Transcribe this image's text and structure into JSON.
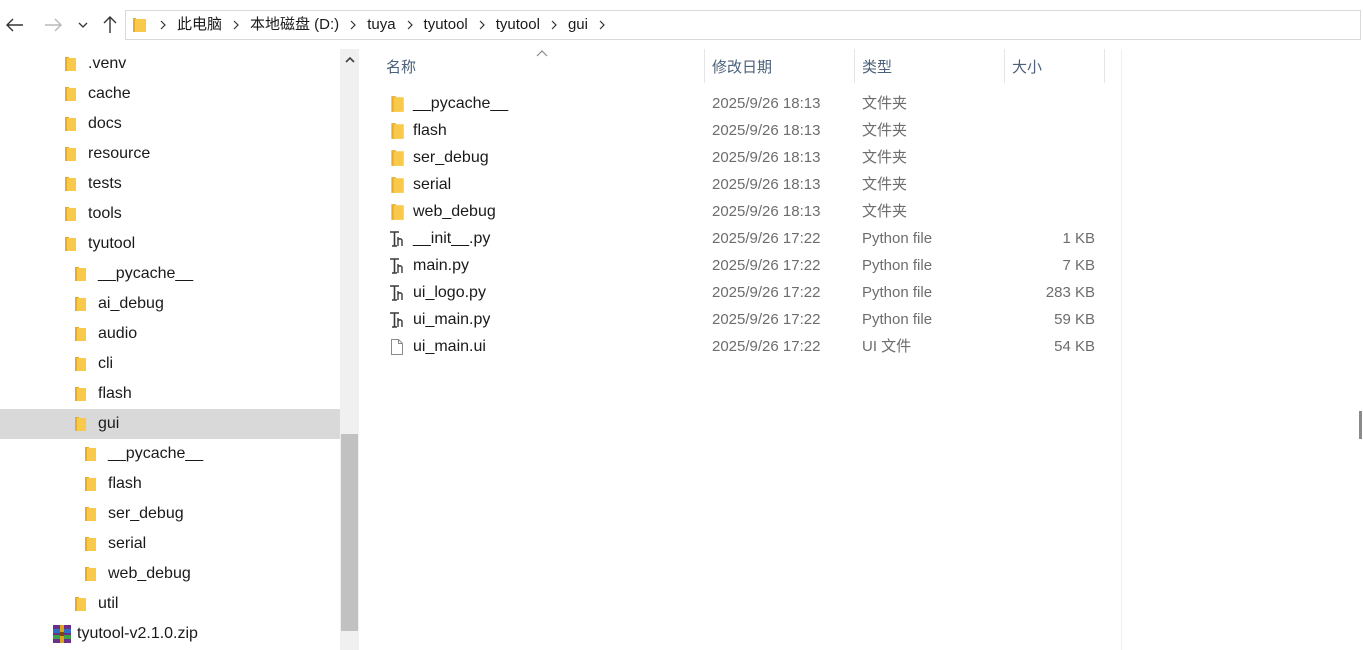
{
  "navigation": {
    "back_icon": "arrow-left-icon",
    "forward_icon": "arrow-right-icon",
    "recent_icon": "chevron-down-icon",
    "up_icon": "arrow-up-icon"
  },
  "breadcrumb": [
    "此电脑",
    "本地磁盘 (D:)",
    "tuya",
    "tyutool",
    "tyutool",
    "gui"
  ],
  "sidebar": {
    "items": [
      {
        "label": ".venv",
        "icon": "folder-icon"
      },
      {
        "label": "cache",
        "icon": "folder-icon"
      },
      {
        "label": "docs",
        "icon": "folder-icon"
      },
      {
        "label": "resource",
        "icon": "folder-icon"
      },
      {
        "label": "tests",
        "icon": "folder-icon"
      },
      {
        "label": "tools",
        "icon": "folder-icon"
      },
      {
        "label": "tyutool",
        "icon": "folder-icon"
      },
      {
        "label": "__pycache__",
        "icon": "folder-icon"
      },
      {
        "label": "ai_debug",
        "icon": "folder-icon"
      },
      {
        "label": "audio",
        "icon": "folder-icon"
      },
      {
        "label": "cli",
        "icon": "folder-icon"
      },
      {
        "label": "flash",
        "icon": "folder-icon"
      },
      {
        "label": "gui",
        "icon": "folder-icon",
        "selected": true
      },
      {
        "label": "__pycache__",
        "icon": "folder-icon"
      },
      {
        "label": "flash",
        "icon": "folder-icon"
      },
      {
        "label": "ser_debug",
        "icon": "folder-icon"
      },
      {
        "label": "serial",
        "icon": "folder-icon"
      },
      {
        "label": "web_debug",
        "icon": "folder-icon"
      },
      {
        "label": "util",
        "icon": "folder-icon"
      },
      {
        "label": "tyutool-v2.1.0.zip",
        "icon": "zip-archive-icon"
      }
    ]
  },
  "columns": {
    "name": "名称",
    "modified": "修改日期",
    "type": "类型",
    "size": "大小"
  },
  "files": [
    {
      "name": "__pycache__",
      "modified": "2025/9/26 18:13",
      "type": "文件夹",
      "size": "",
      "icon": "folder-icon"
    },
    {
      "name": "flash",
      "modified": "2025/9/26 18:13",
      "type": "文件夹",
      "size": "",
      "icon": "folder-icon"
    },
    {
      "name": "ser_debug",
      "modified": "2025/9/26 18:13",
      "type": "文件夹",
      "size": "",
      "icon": "folder-icon"
    },
    {
      "name": "serial",
      "modified": "2025/9/26 18:13",
      "type": "文件夹",
      "size": "",
      "icon": "folder-icon"
    },
    {
      "name": "web_debug",
      "modified": "2025/9/26 18:13",
      "type": "文件夹",
      "size": "",
      "icon": "folder-icon"
    },
    {
      "name": "__init__.py",
      "modified": "2025/9/26 17:22",
      "type": "Python file",
      "size": "1 KB",
      "icon": "python-file-icon"
    },
    {
      "name": "main.py",
      "modified": "2025/9/26 17:22",
      "type": "Python file",
      "size": "7 KB",
      "icon": "python-file-icon"
    },
    {
      "name": "ui_logo.py",
      "modified": "2025/9/26 17:22",
      "type": "Python file",
      "size": "283 KB",
      "icon": "python-file-icon"
    },
    {
      "name": "ui_main.py",
      "modified": "2025/9/26 17:22",
      "type": "Python file",
      "size": "59 KB",
      "icon": "python-file-icon"
    },
    {
      "name": "ui_main.ui",
      "modified": "2025/9/26 17:22",
      "type": "UI 文件",
      "size": "54 KB",
      "icon": "blank-file-icon"
    }
  ],
  "colors": {
    "folder": "#f8c94a",
    "folder_dark": "#e8ad28",
    "selection": "#d9d9d9",
    "header_text": "#4c607a"
  }
}
